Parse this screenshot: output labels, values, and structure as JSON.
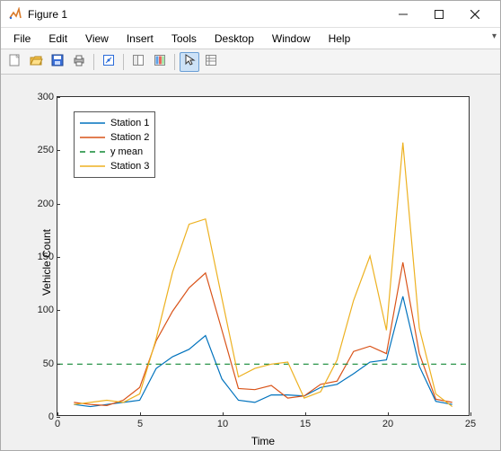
{
  "window": {
    "title": "Figure 1",
    "minimize": "–",
    "maximize": "▢",
    "close": "✕"
  },
  "menubar": {
    "items": [
      "File",
      "Edit",
      "View",
      "Insert",
      "Tools",
      "Desktop",
      "Window",
      "Help"
    ]
  },
  "toolbar": {
    "buttons": [
      {
        "name": "new-figure",
        "glyph": "new"
      },
      {
        "name": "open",
        "glyph": "open"
      },
      {
        "name": "save",
        "glyph": "save"
      },
      {
        "name": "print",
        "glyph": "print"
      },
      {
        "sep": true
      },
      {
        "name": "data-cursor",
        "glyph": "datacursor"
      },
      {
        "sep": true
      },
      {
        "name": "link-plot",
        "glyph": "link"
      },
      {
        "name": "insert-colorbar",
        "glyph": "colorbar"
      },
      {
        "sep": true
      },
      {
        "name": "edit-plot",
        "glyph": "arrow",
        "active": true
      },
      {
        "name": "open-property-inspector",
        "glyph": "inspector"
      }
    ]
  },
  "chart_data": {
    "type": "line",
    "xlabel": "Time",
    "ylabel": "Vehicle Count",
    "xlim": [
      0,
      25
    ],
    "ylim": [
      0,
      300
    ],
    "xticks": [
      0,
      5,
      10,
      15,
      20,
      25
    ],
    "yticks": [
      0,
      50,
      100,
      150,
      200,
      250,
      300
    ],
    "x": [
      1,
      2,
      3,
      4,
      5,
      6,
      7,
      8,
      9,
      10,
      11,
      12,
      13,
      14,
      15,
      16,
      17,
      18,
      19,
      20,
      21,
      22,
      23,
      24
    ],
    "series": [
      {
        "name": "Station 1",
        "color": "#0072bd",
        "dash": "",
        "values": [
          10,
          8,
          10,
          12,
          14,
          44,
          55,
          62,
          75,
          34,
          14,
          12,
          19,
          19,
          18,
          26,
          29,
          39,
          50,
          52,
          112,
          46,
          13,
          10
        ]
      },
      {
        "name": "Station 2",
        "color": "#d95319",
        "dash": "",
        "values": [
          12,
          10,
          9,
          14,
          26,
          70,
          98,
          120,
          134,
          80,
          25,
          24,
          28,
          16,
          18,
          29,
          32,
          60,
          65,
          58,
          144,
          58,
          15,
          12
        ]
      },
      {
        "name": "y mean",
        "color": "#118833",
        "dash": "6,5",
        "constant": 48
      },
      {
        "name": "Station 3",
        "color": "#edb120",
        "dash": "",
        "values": [
          10,
          12,
          14,
          12,
          20,
          72,
          135,
          180,
          185,
          110,
          36,
          44,
          48,
          50,
          16,
          22,
          52,
          108,
          150,
          80,
          257,
          82,
          20,
          8
        ]
      }
    ],
    "legend_order": [
      "Station 1",
      "Station 2",
      "y mean",
      "Station 3"
    ]
  }
}
